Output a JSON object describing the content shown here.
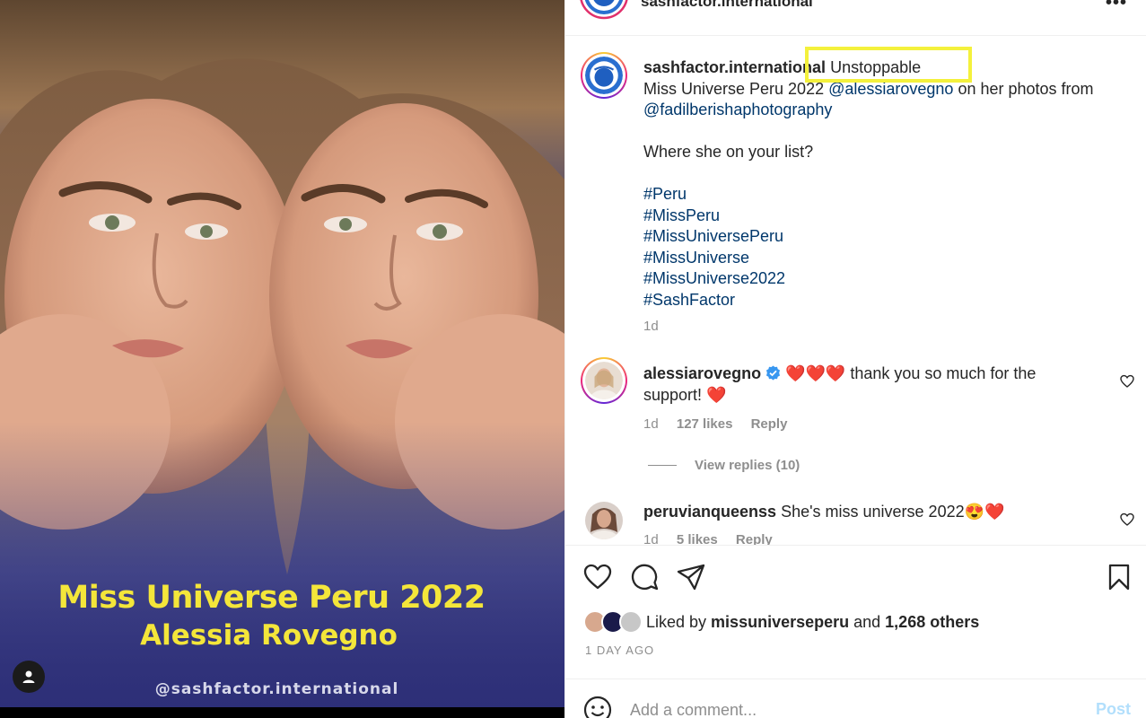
{
  "photo": {
    "title_line1": "Miss Universe Peru 2022",
    "title_line2": "Alessia Rovegno",
    "watermark": "@sashfactor.international",
    "user_tag_icon": "user-icon"
  },
  "header": {
    "username": "sashfactor.international",
    "more_icon": "more-options-icon",
    "more_label": "•••"
  },
  "caption": {
    "username": "sashfactor.international",
    "text_start": " Unstoppable",
    "line2_prefix": "Miss Universe Peru 2022 ",
    "mention1": "@alessiarovegno",
    "line2_suffix": " on her photos from",
    "mention2": "@fadilberishaphotography",
    "question": "Where she on your list?",
    "hashtags": [
      "#Peru",
      "#MissPeru",
      "#MissUniversePeru",
      "#MissUniverse",
      "#MissUniverse2022",
      "#SashFactor"
    ],
    "time": "1d"
  },
  "comments": [
    {
      "username": "alessiarovegno",
      "verified": true,
      "text_line1": " ❤️❤️❤️ thank you so much for the",
      "text_line2": "support! ❤️",
      "time": "1d",
      "likes": "127 likes",
      "reply": "Reply",
      "view_replies": "View replies (10)"
    },
    {
      "username": "peruvianqueenss",
      "text": " She's miss universe 2022😍❤️",
      "time": "1d",
      "likes": "5 likes",
      "reply": "Reply"
    }
  ],
  "actions": {
    "like_icon": "heart-icon",
    "comment_icon": "comment-icon",
    "share_icon": "paper-plane-icon",
    "save_icon": "bookmark-icon"
  },
  "likes": {
    "prefix": "Liked by ",
    "user": "missuniverseperu",
    "middle": " and ",
    "others": "1,268 others"
  },
  "timestamp": "1 DAY AGO",
  "comment_input": {
    "placeholder": "Add a comment...",
    "post_label": "Post",
    "emoji_icon": "smiley-icon"
  },
  "colors": {
    "title_yellow": "#f4e63a",
    "link_blue": "#00376b",
    "post_disabled": "#b2dffc",
    "highlight": "#f4f13c",
    "verified_blue": "#3897f0"
  }
}
